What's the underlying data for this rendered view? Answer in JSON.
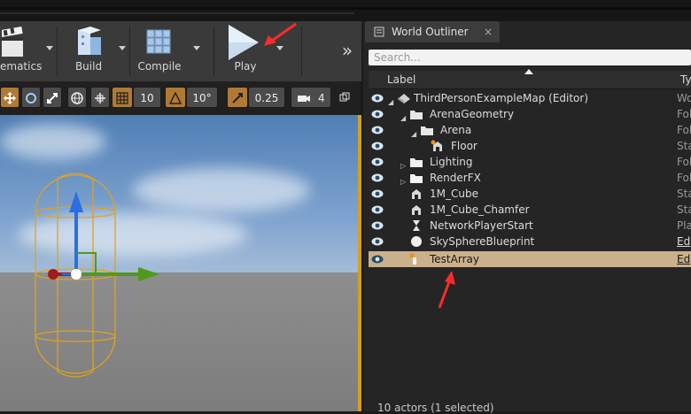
{
  "toolbar": {
    "cinematics_label": "ematics",
    "build_label": "Build",
    "compile_label": "Compile",
    "play_label": "Play",
    "overflow": "»"
  },
  "viewport_toolbar": {
    "grid_size": "10",
    "rotation_snap": "10°",
    "scale_snap": "0.25",
    "camera_speed": "4"
  },
  "outliner": {
    "tab_title": "World Outliner",
    "close": "×",
    "search_placeholder": "Search...",
    "col_label": "Label",
    "col_type": "Ty",
    "rows": [
      {
        "label": "ThirdPersonExampleMap (Editor)",
        "type": "Wo"
      },
      {
        "label": "ArenaGeometry",
        "type": "Fol"
      },
      {
        "label": "Arena",
        "type": "Fol"
      },
      {
        "label": "Floor",
        "type": "Sta"
      },
      {
        "label": "Lighting",
        "type": "Fol"
      },
      {
        "label": "RenderFX",
        "type": "Fol"
      },
      {
        "label": "1M_Cube",
        "type": "Sta"
      },
      {
        "label": "1M_Cube_Chamfer",
        "type": "Sta"
      },
      {
        "label": "NetworkPlayerStart",
        "type": "Pla"
      },
      {
        "label": "SkySphereBlueprint",
        "type": "Ed"
      },
      {
        "label": "TestArray",
        "type": "Ed"
      }
    ],
    "footer": "10 actors (1 selected)"
  },
  "colors": {
    "selection": "#cbb08c",
    "annotation_arrow": "#ff2a2a",
    "viewport_border": "#d4a020"
  }
}
